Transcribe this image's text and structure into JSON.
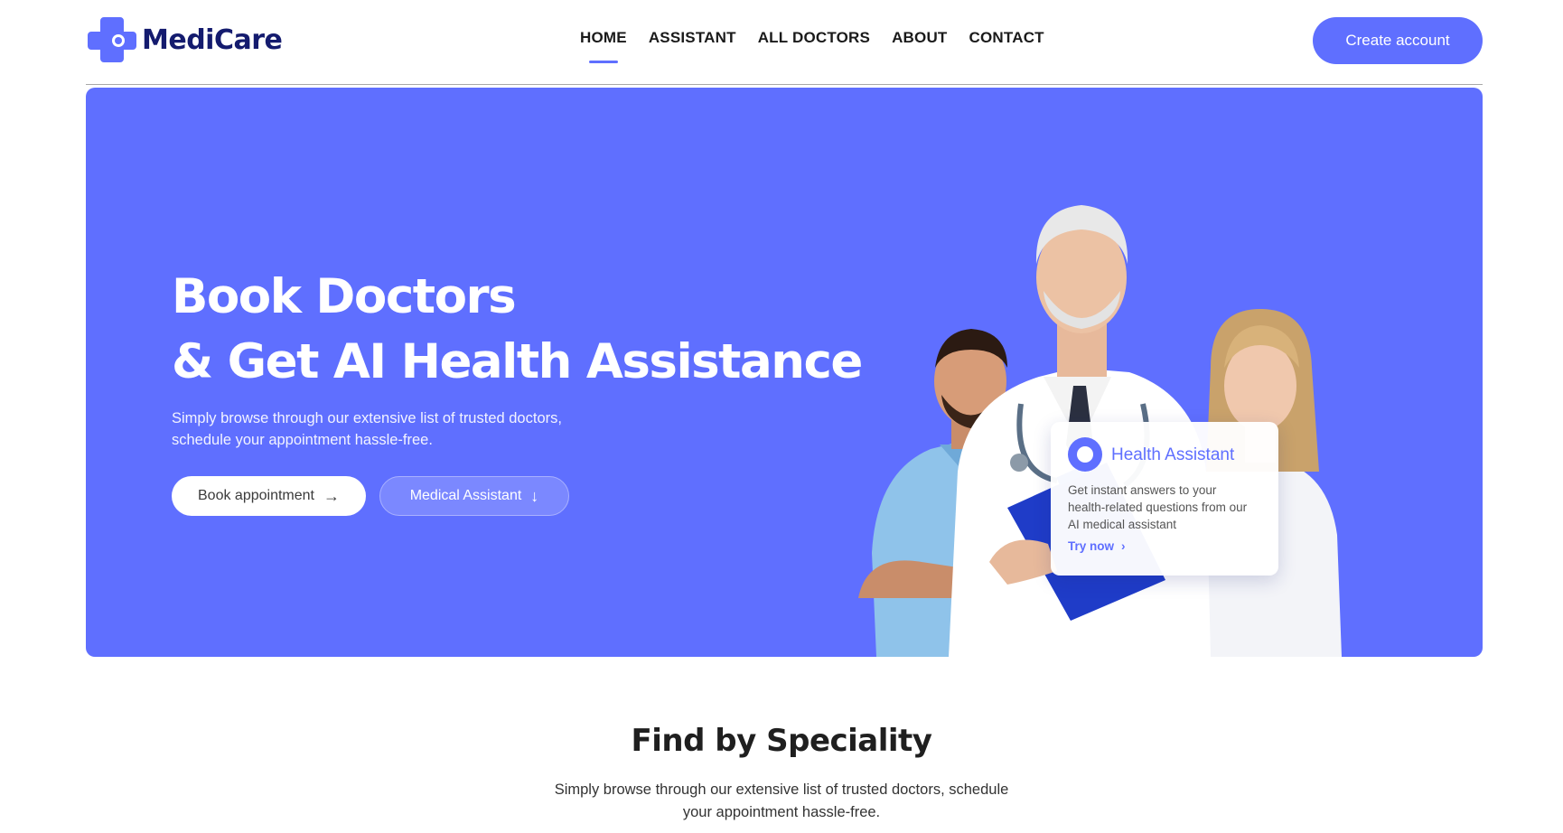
{
  "brand": {
    "name": "MediCare",
    "color": "#5f6fff",
    "text_color": "#141b6e"
  },
  "nav": {
    "items": [
      {
        "label": "HOME",
        "active": true
      },
      {
        "label": "ASSISTANT",
        "active": false
      },
      {
        "label": "ALL DOCTORS",
        "active": false
      },
      {
        "label": "ABOUT",
        "active": false
      },
      {
        "label": "CONTACT",
        "active": false
      }
    ],
    "cta_label": "Create account"
  },
  "hero": {
    "title_line1": "Book Doctors",
    "title_line2": "& Get AI Health Assistance",
    "subtitle_line1": "Simply browse through our extensive list of trusted doctors,",
    "subtitle_line2": "schedule your appointment hassle-free.",
    "book_label": "Book appointment",
    "book_icon": "arrow-right-icon",
    "assistant_label": "Medical Assistant",
    "assistant_icon": "arrow-down-icon",
    "bg_color": "#5f6fff"
  },
  "assistant_card": {
    "title": "Health Assistant",
    "desc_line1": "Get instant answers to your",
    "desc_line2": "health-related questions from our",
    "desc_line3": "AI medical assistant",
    "link_label": "Try now",
    "link_icon": "chevron-right-icon"
  },
  "speciality": {
    "title": "Find by Speciality",
    "subtitle_line1": "Simply browse through our extensive list of trusted doctors, schedule",
    "subtitle_line2": "your appointment hassle-free."
  }
}
